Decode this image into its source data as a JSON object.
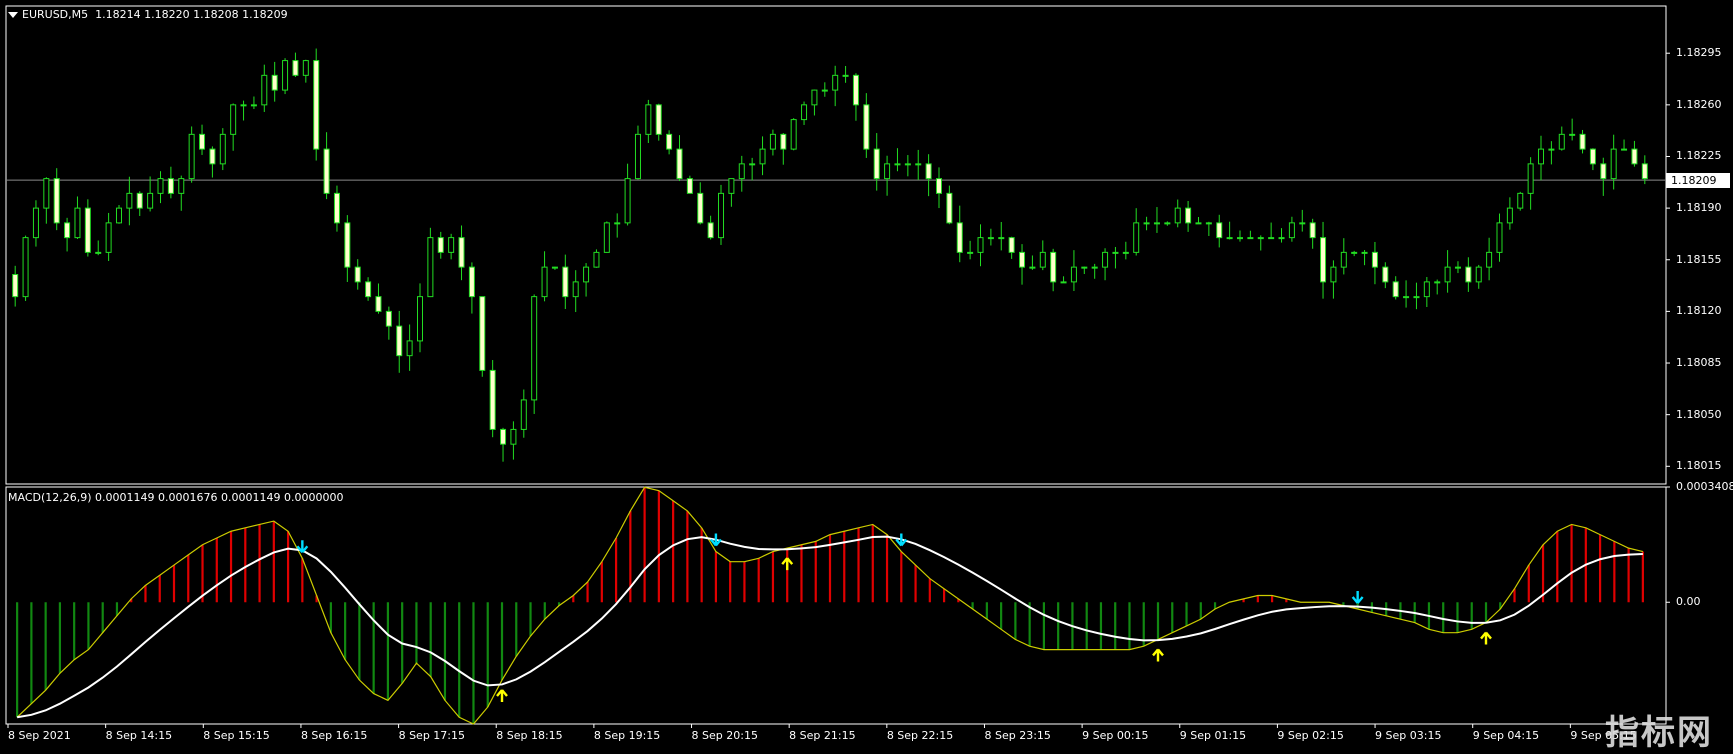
{
  "main_header": {
    "symbol": "EURUSD,M5",
    "ohlc": "1.18214 1.18220 1.18208 1.18209"
  },
  "macd_header": "MACD(12,26,9) 0.0001149 0.0001676 0.0001149 0.0000000",
  "current_price": "1.18209",
  "price_axis_labels": [
    "1.18295",
    "1.18260",
    "1.18225",
    "1.18190",
    "1.18155",
    "1.18120",
    "1.18085",
    "1.18050",
    "1.18015"
  ],
  "macd_axis_labels": [
    "0.0003408",
    "0.00"
  ],
  "time_axis_labels": [
    "8 Sep 2021",
    "8 Sep 14:15",
    "8 Sep 15:15",
    "8 Sep 16:15",
    "8 Sep 17:15",
    "8 Sep 18:15",
    "8 Sep 19:15",
    "8 Sep 20:15",
    "8 Sep 21:15",
    "8 Sep 22:15",
    "8 Sep 23:15",
    "9 Sep 00:15",
    "9 Sep 01:15",
    "9 Sep 02:15",
    "9 Sep 03:15",
    "9 Sep 04:15",
    "9 Sep 05:15"
  ],
  "watermark": "指标网",
  "colors": {
    "background": "#000000",
    "bull_candle": "#ffffcc",
    "bear_candle": "#ffffcc",
    "wick": "#22dd22",
    "grid_line": "#8a8a8a",
    "hist_positive": "#e00000",
    "hist_negative": "#118811",
    "macd_line": "#cccc00",
    "signal_line": "#ffffff",
    "arrow_up": "#ffff00",
    "arrow_down": "#00ddff"
  },
  "chart_data": [
    {
      "type": "candlestick",
      "title": "EURUSD,M5",
      "ylim": [
        1.18003,
        1.18327
      ],
      "close_path": [
        1.1813,
        1.1817,
        1.1819,
        1.1821,
        1.1818,
        1.1817,
        1.1819,
        1.1816,
        1.1816,
        1.1818,
        1.1819,
        1.182,
        1.1819,
        1.182,
        1.1821,
        1.182,
        1.1821,
        1.1824,
        1.1823,
        1.1822,
        1.1824,
        1.1826,
        1.1826,
        1.1826,
        1.1828,
        1.1827,
        1.1829,
        1.1828,
        1.1829,
        1.1823,
        1.182,
        1.1818,
        1.1815,
        1.1814,
        1.1813,
        1.1812,
        1.1811,
        1.1809,
        1.181,
        1.1813,
        1.1817,
        1.1816,
        1.1817,
        1.1815,
        1.1813,
        1.1808,
        1.1804,
        1.1803,
        1.1804,
        1.1806,
        1.1813,
        1.1815,
        1.1815,
        1.1813,
        1.1814,
        1.1815,
        1.1816,
        1.1818,
        1.1818,
        1.1821,
        1.1824,
        1.1826,
        1.1824,
        1.1823,
        1.1821,
        1.182,
        1.1818,
        1.1817,
        1.182,
        1.1821,
        1.1822,
        1.1822,
        1.1823,
        1.1824,
        1.1823,
        1.1825,
        1.1826,
        1.1827,
        1.1827,
        1.1828,
        1.1828,
        1.1826,
        1.1823,
        1.1821,
        1.1822,
        1.1822,
        1.1822,
        1.1822,
        1.1821,
        1.182,
        1.1818,
        1.1816,
        1.1816,
        1.1817,
        1.1817,
        1.1817,
        1.1816,
        1.1815,
        1.1815,
        1.1816,
        1.1814,
        1.1814,
        1.1815,
        1.1815,
        1.1815,
        1.1816,
        1.1816,
        1.1816,
        1.1818,
        1.1818,
        1.1818,
        1.1818,
        1.1819,
        1.1818,
        1.1818,
        1.1818,
        1.1817,
        1.1817,
        1.1817,
        1.1817,
        1.1817,
        1.1817,
        1.1817,
        1.1818,
        1.1818,
        1.1817,
        1.1814,
        1.1815,
        1.1816,
        1.1816,
        1.1816,
        1.1815,
        1.1814,
        1.1813,
        1.1813,
        1.1813,
        1.1814,
        1.1814,
        1.1815,
        1.1815,
        1.1814,
        1.1815,
        1.1816,
        1.1818,
        1.1819,
        1.182,
        1.1822,
        1.1823,
        1.1823,
        1.1824,
        1.1824,
        1.1823,
        1.1822,
        1.1821,
        1.1823,
        1.1823,
        1.1822,
        1.1821
      ]
    },
    {
      "type": "bar",
      "title": "MACD(12,26,9)",
      "ylim": [
        -0.00036,
        0.0003408
      ],
      "values": [
        -0.00034,
        -0.0003,
        -0.00026,
        -0.00021,
        -0.00017,
        -0.00014,
        -9e-05,
        -4e-05,
        1e-05,
        5e-05,
        8e-05,
        0.00011,
        0.00014,
        0.00017,
        0.00019,
        0.00021,
        0.00022,
        0.00023,
        0.00024,
        0.00021,
        0.00013,
        2e-05,
        -9e-05,
        -0.00017,
        -0.00023,
        -0.00027,
        -0.00029,
        -0.00024,
        -0.00018,
        -0.00022,
        -0.00029,
        -0.00034,
        -0.00036,
        -0.00031,
        -0.00023,
        -0.00016,
        -0.0001,
        -5e-05,
        -1e-05,
        2e-05,
        6e-05,
        0.00012,
        0.00019,
        0.00027,
        0.00034,
        0.00033,
        0.0003,
        0.00027,
        0.00022,
        0.00015,
        0.00012,
        0.00012,
        0.00013,
        0.00015,
        0.00016,
        0.00017,
        0.00018,
        0.0002,
        0.00021,
        0.00022,
        0.00023,
        0.0002,
        0.00015,
        0.00011,
        7e-05,
        4e-05,
        1e-05,
        -2e-05,
        -5e-05,
        -8e-05,
        -0.00011,
        -0.00013,
        -0.00014,
        -0.00014,
        -0.00014,
        -0.00014,
        -0.00014,
        -0.00014,
        -0.00014,
        -0.00013,
        -0.00011,
        -9e-05,
        -7e-05,
        -5e-05,
        -2e-05,
        0.0,
        1e-05,
        2e-05,
        2e-05,
        1e-05,
        0.0,
        0.0,
        0.0,
        -1e-05,
        -2e-05,
        -3e-05,
        -4e-05,
        -5e-05,
        -6e-05,
        -8e-05,
        -9e-05,
        -9e-05,
        -8e-05,
        -6e-05,
        -2e-05,
        4e-05,
        0.00011,
        0.00017,
        0.00021,
        0.00023,
        0.00022,
        0.0002,
        0.00018,
        0.00016,
        0.00015
      ]
    }
  ]
}
